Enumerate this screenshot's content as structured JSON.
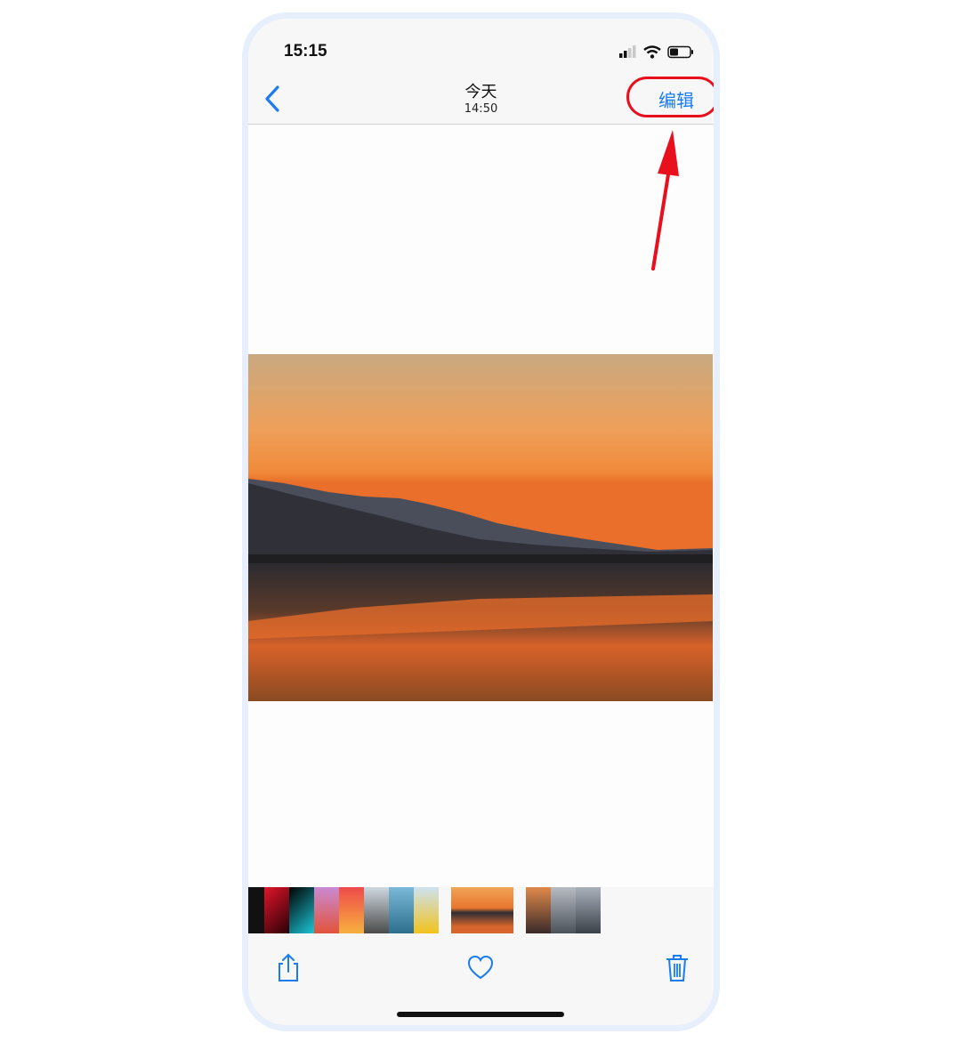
{
  "status_bar": {
    "time": "15:15"
  },
  "nav": {
    "title": "今天",
    "subtitle": "14:50",
    "edit_label": "编辑"
  },
  "toolbar": {
    "share_icon": "share-icon",
    "favorite_icon": "heart-icon",
    "delete_icon": "trash-icon"
  },
  "colors": {
    "accent": "#1a7cf0",
    "annotation": "#e8101c"
  }
}
